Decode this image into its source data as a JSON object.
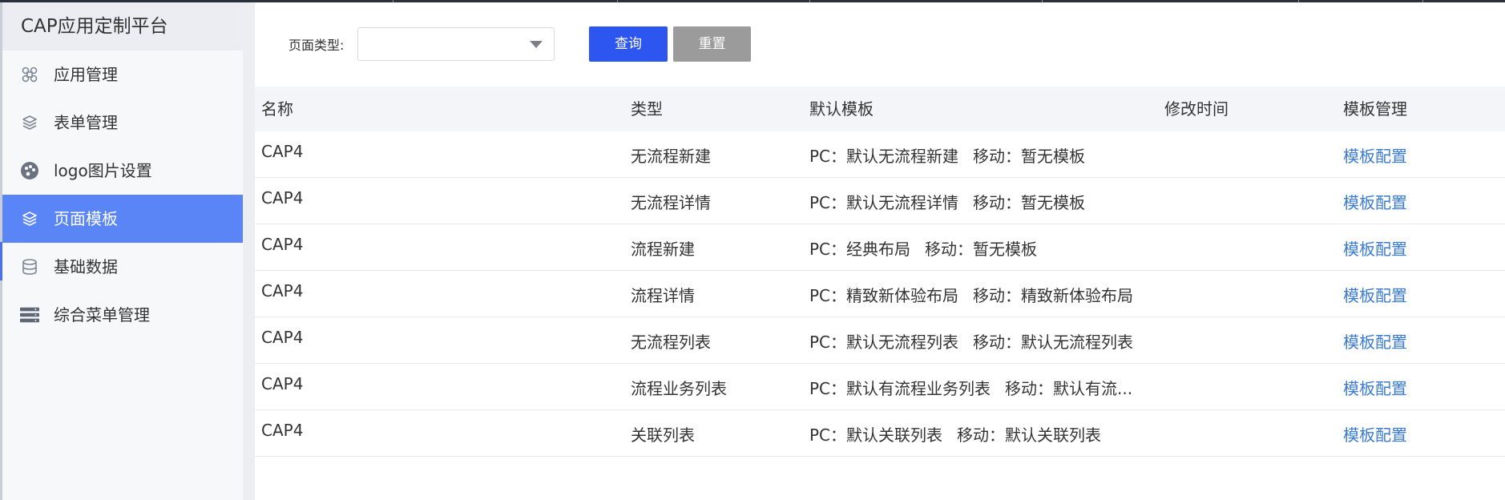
{
  "sidebar": {
    "title": "CAP应用定制平台",
    "items": [
      {
        "label": "应用管理",
        "icon": "command-icon"
      },
      {
        "label": "表单管理",
        "icon": "layers-icon"
      },
      {
        "label": "logo图片设置",
        "icon": "palette-icon"
      },
      {
        "label": "页面模板",
        "icon": "layers-icon",
        "active": true
      },
      {
        "label": "基础数据",
        "icon": "database-icon"
      },
      {
        "label": "综合菜单管理",
        "icon": "server-icon"
      }
    ]
  },
  "filter": {
    "page_type_label": "页面类型:",
    "page_type_value": "",
    "query_label": "查询",
    "reset_label": "重置"
  },
  "table": {
    "headers": [
      "名称",
      "类型",
      "默认模板",
      "修改时间",
      "模板管理"
    ],
    "rows": [
      {
        "name": "CAP4",
        "type": "无流程新建",
        "pc": "PC：默认无流程新建",
        "mobile": "移动：暂无模板",
        "modified": "",
        "action": "模板配置"
      },
      {
        "name": "CAP4",
        "type": "无流程详情",
        "pc": "PC：默认无流程详情",
        "mobile": "移动：暂无模板",
        "modified": "",
        "action": "模板配置"
      },
      {
        "name": "CAP4",
        "type": "流程新建",
        "pc": "PC：经典布局",
        "mobile": "移动：暂无模板",
        "modified": "",
        "action": "模板配置"
      },
      {
        "name": "CAP4",
        "type": "流程详情",
        "pc": "PC：精致新体验布局",
        "mobile": "移动：精致新体验布局",
        "modified": "",
        "action": "模板配置"
      },
      {
        "name": "CAP4",
        "type": "无流程列表",
        "pc": "PC：默认无流程列表",
        "mobile": "移动：默认无流程列表",
        "modified": "",
        "action": "模板配置"
      },
      {
        "name": "CAP4",
        "type": "流程业务列表",
        "pc": "PC：默认有流程业务列表",
        "mobile": "移动：默认有流...",
        "modified": "",
        "action": "模板配置"
      },
      {
        "name": "CAP4",
        "type": "关联列表",
        "pc": "PC：默认关联列表",
        "mobile": "移动：默认关联列表",
        "modified": "",
        "action": "模板配置"
      }
    ]
  },
  "colors": {
    "accent": "#2d55f0",
    "active_menu": "#5a85f7",
    "link": "#3a7bd5",
    "reset_button": "#9b9b9b"
  }
}
